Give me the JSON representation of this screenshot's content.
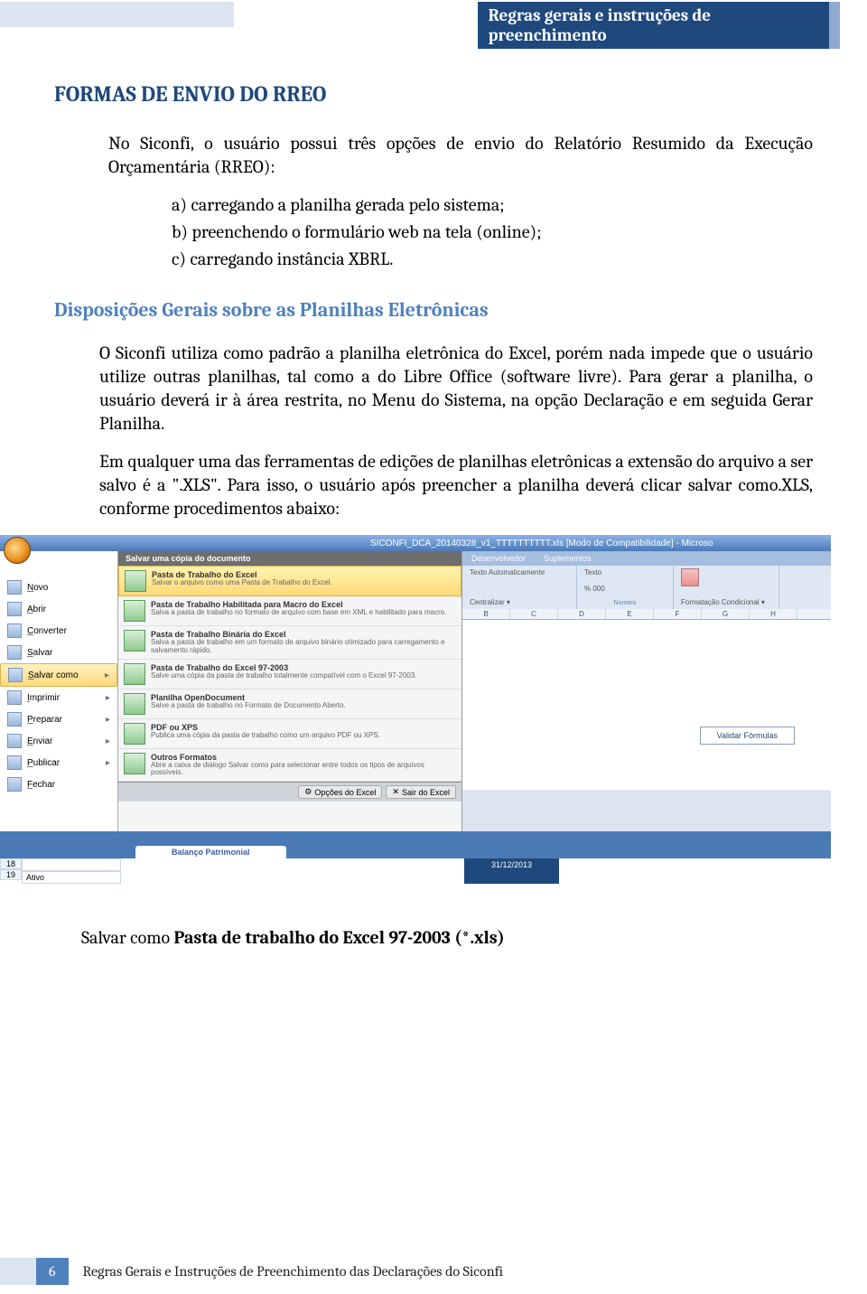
{
  "banner": "Regras gerais e instruções de preenchimento",
  "h1": "FORMAS DE ENVIO DO RREO",
  "intro": "No Siconfi, o usuário possui três opções de envio do Relatório Resumido da Execução Orçamentária (RREO):",
  "opts": {
    "a": "a) carregando a planilha gerada pelo sistema;",
    "b": "b) preenchendo o formulário web na tela (online);",
    "c": "c) carregando instância XBRL."
  },
  "h2": "Disposições Gerais sobre as Planilhas Eletrônicas",
  "p1": "O Siconfi utiliza como padrão a planilha eletrônica do Excel, porém nada impede que o usuário utilize outras planilhas, tal como a do Libre Office (software livre). Para gerar a planilha, o usuário deverá ir à área restrita, no Menu do Sistema, na opção Declaração e em seguida Gerar Planilha.",
  "p2": "Em qualquer uma das ferramentas de edições de planilhas eletrônicas a extensão do arquivo a ser salvo é a \".XLS\". Para isso, o usuário após preencher a planilha deverá clicar salvar como.XLS, conforme procedimentos abaixo:",
  "screenshot": {
    "title": "SICONFI_DCA_20140328_v1_TTTTTTTTTT.xls  [Modo de Compatibilidade] - Microso",
    "leftMenu": [
      {
        "l": "Novo",
        "u": "N"
      },
      {
        "l": "Abrir",
        "u": "A"
      },
      {
        "l": "Converter",
        "u": "C"
      },
      {
        "l": "Salvar",
        "u": "S"
      },
      {
        "l": "Salvar como",
        "u": "S",
        "hl": true,
        "arrow": true
      },
      {
        "l": "Imprimir",
        "u": "I",
        "arrow": true
      },
      {
        "l": "Preparar",
        "u": "P",
        "arrow": true
      },
      {
        "l": "Enviar",
        "u": "E",
        "arrow": true
      },
      {
        "l": "Publicar",
        "u": "P",
        "arrow": true
      },
      {
        "l": "Fechar",
        "u": "F"
      }
    ],
    "midHeader": "Salvar uma cópia do documento",
    "midItems": [
      {
        "t": "Pasta de Trabalho do Excel",
        "d": "Salvar o arquivo como uma Pasta de Trabalho do Excel.",
        "sel": true
      },
      {
        "t": "Pasta de Trabalho Habilitada para Macro do Excel",
        "d": "Salva a pasta de trabalho no formato de arquivo com base em XML e habilitado para macro."
      },
      {
        "t": "Pasta de Trabalho Binária do Excel",
        "d": "Salva a pasta de trabalho em um formato de arquivo binário otimizado para carregamento e salvamento rápido."
      },
      {
        "t": "Pasta de Trabalho do Excel 97-2003",
        "d": "Salve uma cópia da pasta de trabalho totalmente compatível com o Excel 97-2003."
      },
      {
        "t": "Planilha OpenDocument",
        "d": "Salve a pasta de trabalho no Formato de Documento Aberto."
      },
      {
        "t": "PDF ou XPS",
        "d": "Publica uma cópia da pasta de trabalho como um arquivo PDF ou XPS."
      },
      {
        "t": "Outros Formatos",
        "d": "Abre a caixa de diálogo Salvar como para selecionar entre todos os tipos de arquivos possíveis."
      }
    ],
    "footerBtns": [
      "Opções do Excel",
      "Sair do Excel"
    ],
    "rightTabs": [
      "Desenvolvedor",
      "Suplementos"
    ],
    "ribbon": {
      "g1a": "Texto Automaticamente",
      "g1b": "Centralizar ▾",
      "g2a": "Texto",
      "g2b": "% 000",
      "g3": "Formatação Condicional ▾"
    },
    "numero": "Número",
    "cols": [
      "B",
      "C",
      "D",
      "E",
      "F",
      "G",
      "H"
    ],
    "validar": "Validar Fórmulas",
    "sheetTab": "Balanço Patrimonial",
    "row18": "18",
    "row19": "19",
    "ativo": "Ativo",
    "date": "31/12/2013"
  },
  "salvar_pre": "Salvar como ",
  "salvar_bold": "Pasta de trabalho do Excel 97-2003 (*.xls)",
  "pagenum": "6",
  "footer_text": "Regras Gerais e Instruções de Preenchimento das Declarações do Siconfi"
}
